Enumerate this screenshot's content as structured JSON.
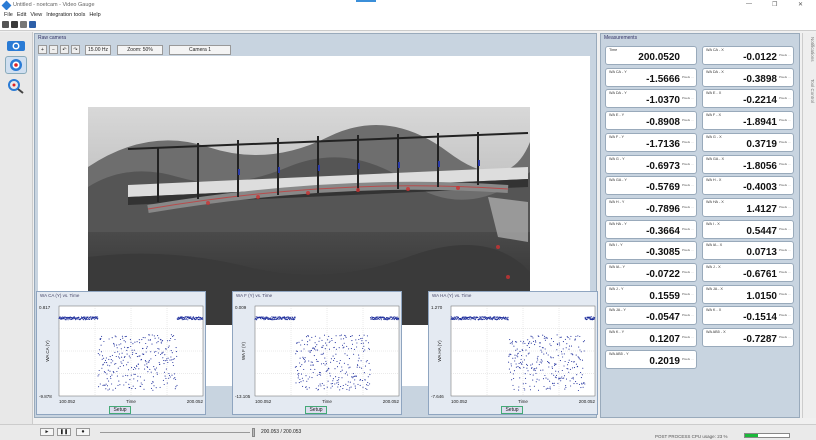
{
  "window": {
    "title": "Untitled - noetcam - Video Gauge",
    "minimize": "—",
    "maximize": "❐",
    "close": "✕"
  },
  "menu": [
    "File",
    "Edit",
    "View",
    "Integration tools",
    "Help"
  ],
  "view_panel": {
    "label": "Raw camera",
    "fps": "15.00 Hz",
    "zoom": "Zoom: 50%",
    "camera": "Camera 1"
  },
  "charts": [
    {
      "title": "WA CA (Y) vs. Time",
      "ylabel": "WA CA (Y)",
      "ymax": "0.817",
      "ymin": "-9.878",
      "xmin": "100.052",
      "xmax": "200.052",
      "xlabel": "Time",
      "setup": "Setup"
    },
    {
      "title": "WA F (Y) vs. Time",
      "ylabel": "WA F (Y)",
      "ymax": "0.009",
      "ymin": "-13.105",
      "xmin": "100.052",
      "xmax": "200.052",
      "xlabel": "Time",
      "setup": "Setup"
    },
    {
      "title": "WA HA (Y) vs. Time",
      "ylabel": "WA HA (Y)",
      "ymax": "1.270",
      "ymin": "-7.646",
      "xmin": "100.052",
      "xmax": "200.052",
      "xlabel": "Time",
      "setup": "Setup"
    }
  ],
  "measurements": {
    "title": "Measurements",
    "left": [
      {
        "label": "Time",
        "value": "200.0520",
        "unit": ""
      },
      {
        "label": "WA CA - Y",
        "value": "-1.5666",
        "unit": "Pixels …"
      },
      {
        "label": "WA DA - Y",
        "value": "-1.0370",
        "unit": "Pixels …"
      },
      {
        "label": "WA E - Y",
        "value": "-0.8908",
        "unit": "Pixels …"
      },
      {
        "label": "WA F - Y",
        "value": "-1.7136",
        "unit": "Pixels …"
      },
      {
        "label": "WA G - Y",
        "value": "-0.6973",
        "unit": "Pixels …"
      },
      {
        "label": "WA GA - Y",
        "value": "-0.5769",
        "unit": "Pixels …"
      },
      {
        "label": "WA H - Y",
        "value": "-0.7896",
        "unit": "Pixels …"
      },
      {
        "label": "WA HA - Y",
        "value": "-0.3664",
        "unit": "Pixels …"
      },
      {
        "label": "WA I - Y",
        "value": "-0.3085",
        "unit": "Pixels …"
      },
      {
        "label": "WA IA - Y",
        "value": "-0.0722",
        "unit": "Pixels …"
      },
      {
        "label": "WA J - Y",
        "value": "0.1559",
        "unit": "Pixels …"
      },
      {
        "label": "WA JA - Y",
        "value": "-0.0547",
        "unit": "Pixels …"
      },
      {
        "label": "WA K - Y",
        "value": "0.1207",
        "unit": "Pixels …"
      },
      {
        "label": "WA AB5 - Y",
        "value": "0.2019",
        "unit": "Pixels …"
      }
    ],
    "right": [
      {
        "label": "WA CA - X",
        "value": "-0.0122",
        "unit": "Pixels …"
      },
      {
        "label": "WA DA - X",
        "value": "-0.3898",
        "unit": "Pixels …"
      },
      {
        "label": "WA E - X",
        "value": "-0.2214",
        "unit": "Pixels …"
      },
      {
        "label": "WA F - X",
        "value": "-1.8941",
        "unit": "Pixels …"
      },
      {
        "label": "WA G - X",
        "value": "0.3719",
        "unit": "Pixels …"
      },
      {
        "label": "WA GA - X",
        "value": "-1.8056",
        "unit": "Pixels …"
      },
      {
        "label": "WA H - X",
        "value": "-0.4003",
        "unit": "Pixels …"
      },
      {
        "label": "WA HA - X",
        "value": "1.4127",
        "unit": "Pixels …"
      },
      {
        "label": "WA I - X",
        "value": "0.5447",
        "unit": "Pixels …"
      },
      {
        "label": "WA IA - X",
        "value": "0.0713",
        "unit": "Pixels …"
      },
      {
        "label": "WA J - X",
        "value": "-0.6761",
        "unit": "Pixels …"
      },
      {
        "label": "WA JA - X",
        "value": "1.0150",
        "unit": "Pixels …"
      },
      {
        "label": "WA K - X",
        "value": "-0.1514",
        "unit": "Pixels …"
      },
      {
        "label": "WA AB5 - X",
        "value": "-0.7287",
        "unit": "Pixels …"
      }
    ]
  },
  "side_tabs": [
    "Notifications",
    "Tool Control"
  ],
  "status": {
    "frame": "200.053 / 200.053",
    "text": "POST PROCESS  CPU usage: 23 %",
    "cpu_fraction": 0.3
  },
  "colors": {
    "panel": "#c8d4e0",
    "plot_point": "#1a2a9a",
    "cpu": "#1bb83a"
  },
  "icons": [
    "app-icon",
    "new-file-icon",
    "open-icon",
    "save-icon",
    "camera-icon",
    "target-icon",
    "gauge-tool-icon",
    "zoom-in-icon",
    "zoom-out-icon",
    "rotate-left-icon",
    "rotate-right-icon",
    "play-icon",
    "stop-icon",
    "record-icon"
  ]
}
